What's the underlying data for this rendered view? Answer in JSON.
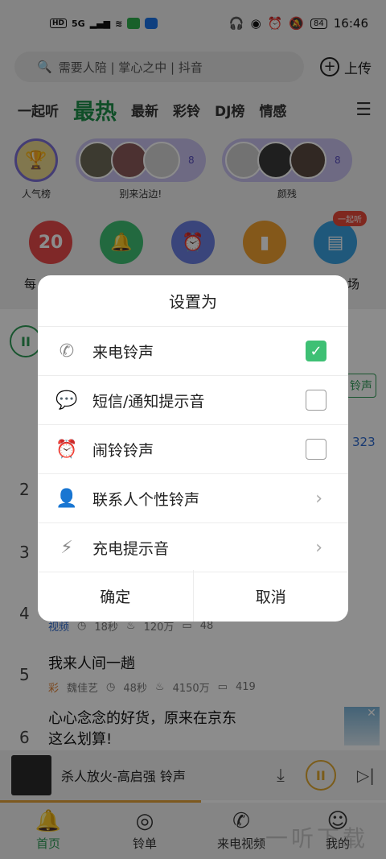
{
  "statusbar": {
    "net": "HD",
    "signal": "5G",
    "battery": "84",
    "time": "16:46"
  },
  "search": {
    "placeholder": "需要人陪 | 掌心之中 | 抖音",
    "upload_label": "上传"
  },
  "tabs": {
    "items": [
      "一起听",
      "最热",
      "最新",
      "彩铃",
      "DJ榜",
      "情感"
    ],
    "active": "最热"
  },
  "avatars": {
    "items": [
      {
        "label": "人气榜",
        "badge": "榜"
      },
      {
        "label": "别来沾边!",
        "count": "8"
      },
      {
        "label": "颜残",
        "count": "8"
      }
    ]
  },
  "funcs": {
    "calendar_day": "20",
    "first_label": "每",
    "last_label": "场",
    "badge": "一起听"
  },
  "list": {
    "ring_tag": "铃声",
    "count": "323",
    "rows": [
      {
        "num": "2"
      },
      {
        "num": "3"
      },
      {
        "num": "4",
        "tag": "视频",
        "duration": "18秒",
        "plays": "120万",
        "comments": "48"
      },
      {
        "num": "5",
        "title": "我来人间一趟",
        "tag": "彩",
        "artist": "魏佳艺",
        "duration": "48秒",
        "plays": "4150万",
        "comments": "419"
      },
      {
        "num": "6",
        "title_line1": "心心念念的好货，原来在京东",
        "title_line2": "这么划算!"
      }
    ]
  },
  "player": {
    "title": "杀人放火-高启强 铃声"
  },
  "bottomnav": {
    "items": [
      "首页",
      "铃单",
      "来电视频",
      "我的"
    ]
  },
  "watermark": "一听下载",
  "dialog": {
    "title": "设置为",
    "options": [
      {
        "label": "来电铃声",
        "icon": "phone-icon",
        "control": "checkbox",
        "checked": true
      },
      {
        "label": "短信/通知提示音",
        "icon": "message-icon",
        "control": "checkbox",
        "checked": false
      },
      {
        "label": "闹铃铃声",
        "icon": "alarm-icon",
        "control": "checkbox",
        "checked": false
      },
      {
        "label": "联系人个性铃声",
        "icon": "contact-icon",
        "control": "chevron"
      },
      {
        "label": "充电提示音",
        "icon": "charging-icon",
        "control": "chevron"
      }
    ],
    "confirm": "确定",
    "cancel": "取消"
  },
  "colors": {
    "accent": "#3ec074",
    "brand_green": "#1e8f4a",
    "player_accent": "#e0a830"
  }
}
